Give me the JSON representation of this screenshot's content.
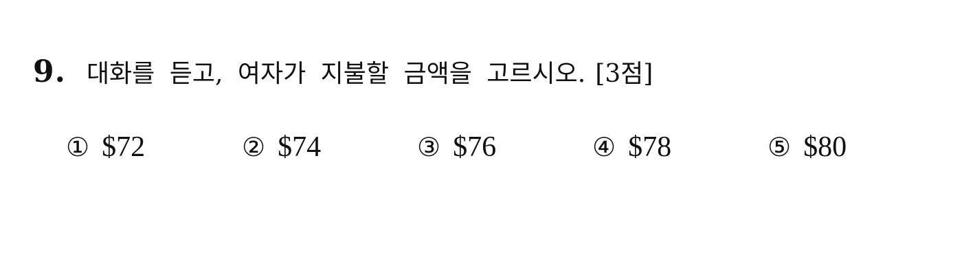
{
  "question": {
    "number": "9.",
    "text": "대화를 듣고, 여자가 지불할 금액을 고르시오.",
    "points": "[3점]"
  },
  "choices": [
    {
      "marker": "①",
      "value": "$72"
    },
    {
      "marker": "②",
      "value": "$74"
    },
    {
      "marker": "③",
      "value": "$76"
    },
    {
      "marker": "④",
      "value": "$78"
    },
    {
      "marker": "⑤",
      "value": "$80"
    }
  ]
}
